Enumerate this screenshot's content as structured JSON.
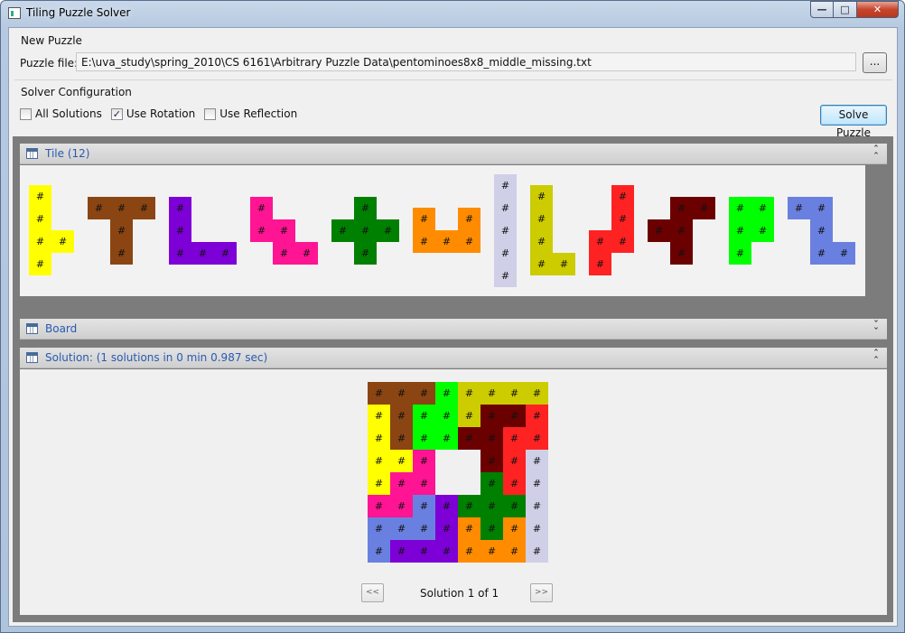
{
  "window": {
    "title": "Tiling Puzzle Solver"
  },
  "new_puzzle": {
    "group_label": "New Puzzle",
    "file_label": "Puzzle file:",
    "file_path": "E:\\uva_study\\spring_2010\\CS 6161\\Arbitrary Puzzle Data\\pentominoes8x8_middle_missing.txt",
    "browse_label": "..."
  },
  "solver_config": {
    "group_label": "Solver Configuration",
    "options": [
      {
        "label": "All Solutions",
        "checked": false
      },
      {
        "label": "Use Rotation",
        "checked": true
      },
      {
        "label": "Use Reflection",
        "checked": false
      }
    ],
    "solve_label": "Solve Puzzle"
  },
  "panels": {
    "tile": {
      "title": "Tile (12)",
      "expanded": true
    },
    "board": {
      "title": "Board",
      "expanded": false
    },
    "solution": {
      "title": "Solution: (1 solutions in 0 min 0.987 sec)",
      "expanded": true
    }
  },
  "cell_mark": "#",
  "tiles": [
    {
      "color": "#ffff00",
      "cells": [
        [
          0,
          0
        ],
        [
          0,
          1
        ],
        [
          0,
          2
        ],
        [
          1,
          2
        ],
        [
          0,
          3
        ]
      ]
    },
    {
      "color": "#8b4513",
      "cells": [
        [
          0,
          0
        ],
        [
          1,
          0
        ],
        [
          2,
          0
        ],
        [
          1,
          1
        ],
        [
          1,
          2
        ]
      ]
    },
    {
      "color": "#7d00d6",
      "cells": [
        [
          0,
          0
        ],
        [
          0,
          1
        ],
        [
          0,
          2
        ],
        [
          1,
          2
        ],
        [
          2,
          2
        ]
      ]
    },
    {
      "color": "#ff1493",
      "cells": [
        [
          0,
          0
        ],
        [
          0,
          1
        ],
        [
          1,
          1
        ],
        [
          1,
          2
        ],
        [
          2,
          2
        ]
      ]
    },
    {
      "color": "#008000",
      "cells": [
        [
          1,
          0
        ],
        [
          0,
          1
        ],
        [
          1,
          1
        ],
        [
          2,
          1
        ],
        [
          1,
          2
        ]
      ]
    },
    {
      "color": "#ff8c00",
      "cells": [
        [
          0,
          0
        ],
        [
          2,
          0
        ],
        [
          0,
          1
        ],
        [
          1,
          1
        ],
        [
          2,
          1
        ]
      ]
    },
    {
      "color": "#cfcfe8",
      "cells": [
        [
          0,
          0
        ],
        [
          0,
          1
        ],
        [
          0,
          2
        ],
        [
          0,
          3
        ],
        [
          0,
          4
        ]
      ]
    },
    {
      "color": "#cccc00",
      "cells": [
        [
          0,
          0
        ],
        [
          0,
          1
        ],
        [
          0,
          2
        ],
        [
          0,
          3
        ],
        [
          1,
          3
        ]
      ]
    },
    {
      "color": "#ff2222",
      "cells": [
        [
          1,
          0
        ],
        [
          1,
          1
        ],
        [
          0,
          2
        ],
        [
          1,
          2
        ],
        [
          0,
          3
        ]
      ]
    },
    {
      "color": "#6b0000",
      "cells": [
        [
          1,
          0
        ],
        [
          2,
          0
        ],
        [
          0,
          1
        ],
        [
          1,
          1
        ],
        [
          1,
          2
        ]
      ]
    },
    {
      "color": "#00ff00",
      "cells": [
        [
          0,
          0
        ],
        [
          1,
          0
        ],
        [
          0,
          1
        ],
        [
          1,
          1
        ],
        [
          0,
          2
        ]
      ]
    },
    {
      "color": "#6a80e0",
      "cells": [
        [
          0,
          0
        ],
        [
          1,
          0
        ],
        [
          1,
          1
        ],
        [
          1,
          2
        ],
        [
          2,
          2
        ]
      ]
    }
  ],
  "solution_grid": [
    [
      "#8b4513",
      "#8b4513",
      "#8b4513",
      "#00ff00",
      "#cccc00",
      "#cccc00",
      "#cccc00",
      "#cccc00"
    ],
    [
      "#ffff00",
      "#8b4513",
      "#00ff00",
      "#00ff00",
      "#cccc00",
      "#6b0000",
      "#6b0000",
      "#ff2222"
    ],
    [
      "#ffff00",
      "#8b4513",
      "#00ff00",
      "#00ff00",
      "#6b0000",
      "#6b0000",
      "#ff2222",
      "#ff2222"
    ],
    [
      "#ffff00",
      "#ffff00",
      "#ff1493",
      null,
      null,
      "#6b0000",
      "#ff2222",
      "#cfcfe8"
    ],
    [
      "#ffff00",
      "#ff1493",
      "#ff1493",
      null,
      null,
      "#008000",
      "#ff2222",
      "#cfcfe8"
    ],
    [
      "#ff1493",
      "#ff1493",
      "#6a80e0",
      "#7d00d6",
      "#008000",
      "#008000",
      "#008000",
      "#cfcfe8"
    ],
    [
      "#6a80e0",
      "#6a80e0",
      "#6a80e0",
      "#7d00d6",
      "#ff8c00",
      "#008000",
      "#ff8c00",
      "#cfcfe8"
    ],
    [
      "#6a80e0",
      "#7d00d6",
      "#7d00d6",
      "#7d00d6",
      "#ff8c00",
      "#ff8c00",
      "#ff8c00",
      "#cfcfe8"
    ]
  ],
  "navigation": {
    "prev_label": "<<",
    "status": "Solution 1 of 1",
    "next_label": ">>"
  }
}
